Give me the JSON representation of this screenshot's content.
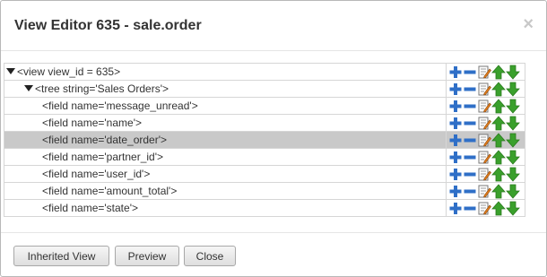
{
  "dialog": {
    "title": "View Editor 635 - sale.order",
    "close_glyph": "×"
  },
  "tree": {
    "rows": [
      {
        "label": "<view view_id = 635>",
        "expanded": true
      },
      {
        "label": "<tree string='Sales Orders'>",
        "expanded": true
      },
      {
        "label": "<field name='message_unread'>",
        "expanded": false
      },
      {
        "label": "<field name='name'>",
        "expanded": false
      },
      {
        "label": "<field name='date_order'>",
        "expanded": false,
        "selected": true
      },
      {
        "label": "<field name='partner_id'>",
        "expanded": false
      },
      {
        "label": "<field name='user_id'>",
        "expanded": false
      },
      {
        "label": "<field name='amount_total'>",
        "expanded": false
      },
      {
        "label": "<field name='state'>",
        "expanded": false
      }
    ],
    "row_actions": [
      "add-icon",
      "remove-icon",
      "edit-icon",
      "move-up-icon",
      "move-down-icon"
    ]
  },
  "footer": {
    "inherited_view_label": "Inherited View",
    "preview_label": "Preview",
    "close_label": "Close"
  },
  "colors": {
    "add": "#2f6fc7",
    "remove": "#2f6fc7",
    "arrow": "#3aa02c",
    "selected_row": "#c9c9c9"
  }
}
